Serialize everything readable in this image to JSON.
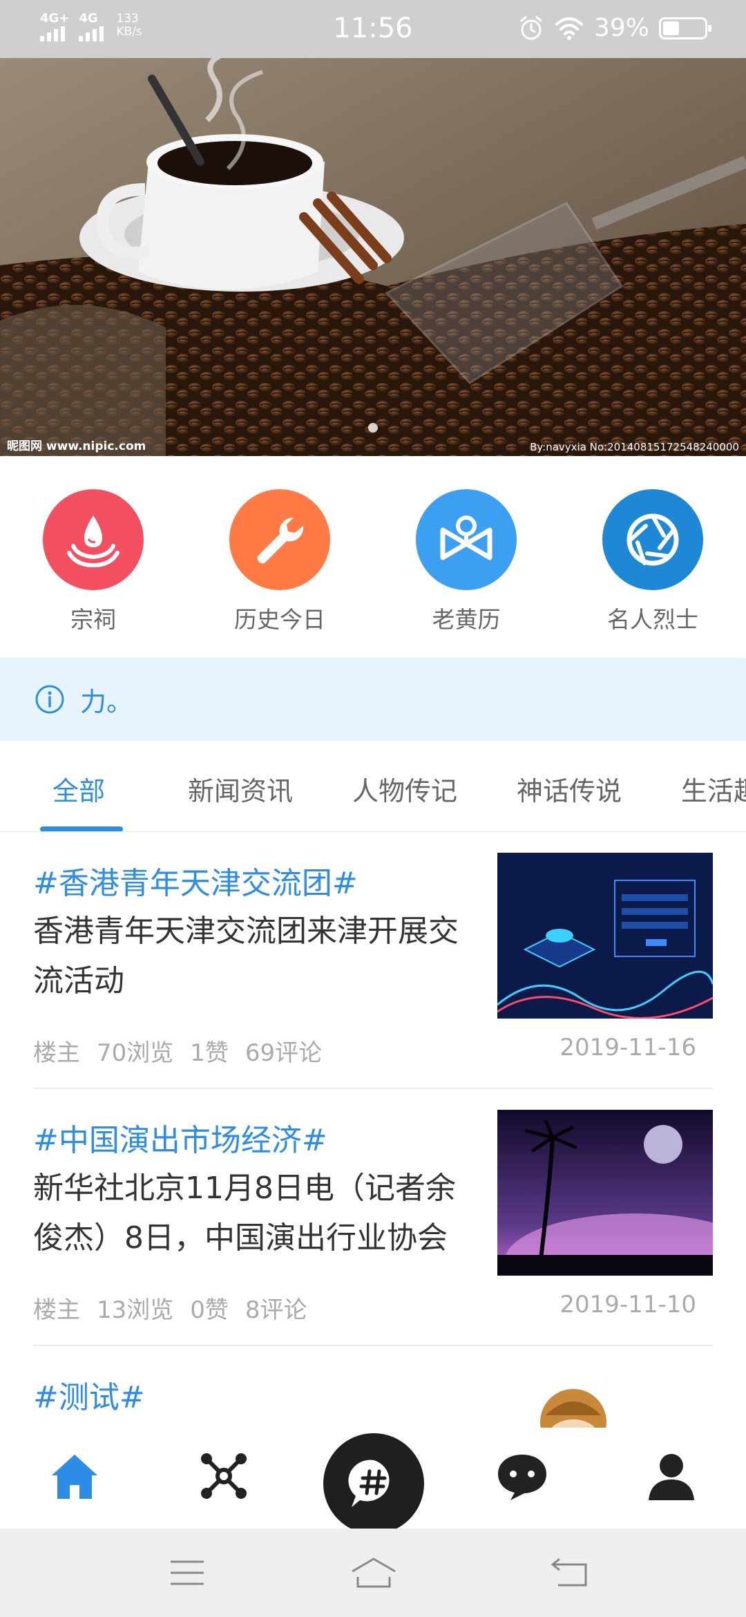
{
  "status_bar": {
    "signal1": "4G+",
    "signal2": "4G",
    "speed_value": "133",
    "speed_unit": "KB/s",
    "time": "11:56",
    "battery": "39%",
    "battery_level": 0.39
  },
  "banner": {
    "watermark_left": "昵图网 www.nipic.com",
    "watermark_right": "By:navyxia No:20140815172548240000",
    "page_count": 1,
    "active_page": 0
  },
  "quick_grid": [
    {
      "label": "宗祠",
      "icon": "ancestral-hall-icon",
      "color": "#f25060"
    },
    {
      "label": "历史今日",
      "icon": "wrench-icon",
      "color": "#ff7a45"
    },
    {
      "label": "老黄历",
      "icon": "almanac-icon",
      "color": "#3c9ff2"
    },
    {
      "label": "名人烈士",
      "icon": "shutter-icon",
      "color": "#1e88d6"
    }
  ],
  "notice": {
    "icon": "info-icon",
    "text": "力。"
  },
  "tabs": [
    {
      "label": "全部",
      "active": true
    },
    {
      "label": "新闻资讯",
      "active": false
    },
    {
      "label": "人物传记",
      "active": false
    },
    {
      "label": "神话传说",
      "active": false
    },
    {
      "label": "生活趣",
      "active": false
    }
  ],
  "feed": [
    {
      "tag": "#香港青年天津交流团#",
      "body": "香港青年天津交流团来津开展交流活动",
      "author": "楼主",
      "views": "70浏览",
      "likes": "1赞",
      "comments": "69评论",
      "date": "2019-11-16"
    },
    {
      "tag": "#中国演出市场经济#",
      "body": "新华社北京11月8日电（记者余俊杰）8日，中国演出行业协会",
      "author": "楼主",
      "views": "13浏览",
      "likes": "0赞",
      "comments": "8评论",
      "date": "2019-11-10"
    },
    {
      "tag": "#测试#"
    }
  ],
  "bottom_nav": [
    {
      "icon": "home-icon",
      "active": true
    },
    {
      "icon": "network-icon",
      "active": false
    },
    {
      "icon": "hashtag-icon",
      "center": true
    },
    {
      "icon": "chat-icon",
      "active": false
    },
    {
      "icon": "user-icon",
      "active": false
    }
  ],
  "colors": {
    "accent": "#2d8ce6",
    "notice_bg": "#e8f4fc",
    "status_bar_bg": "#cfcfcf"
  }
}
